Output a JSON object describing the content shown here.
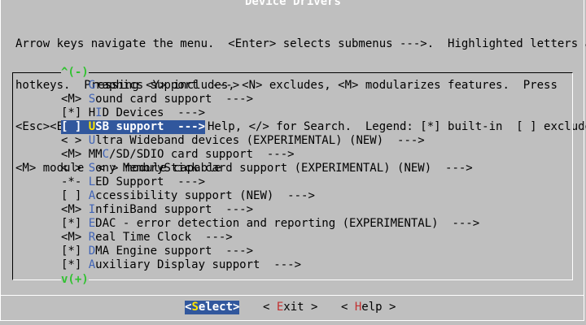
{
  "dialog": {
    "title": "Device Drivers",
    "help_lines": [
      "Arrow keys navigate the menu.  <Enter> selects submenus --->.  Highlighted letters are",
      "hotkeys.  Pressing <Y> includes, <N> excludes, <M> modularizes features.  Press",
      "<Esc><Esc> to exit, <?> for Help, </> for Search.  Legend: [*] built-in  [ ] excluded",
      "<M> module  < > module capable"
    ],
    "scroll_up": "^(-)",
    "scroll_down": "v(+)"
  },
  "menu": {
    "items": [
      {
        "prefix": "    ",
        "hot": "G",
        "rest": "raphics support  --->"
      },
      {
        "prefix": "<M> ",
        "hot": "S",
        "rest": "ound card support  --->"
      },
      {
        "prefix": "[*] ",
        "pre": "H",
        "hot": "I",
        "rest": "D Devices  --->"
      },
      {
        "prefix": "[ ] ",
        "hot": "U",
        "rest": "SB support  --->",
        "selected": true
      },
      {
        "prefix": "< > ",
        "hot": "U",
        "rest": "ltra Wideband devices (EXPERIMENTAL) (NEW)  --->"
      },
      {
        "prefix": "<M> ",
        "pre": "MM",
        "hot": "C",
        "rest": "/SD/SDIO card support  --->"
      },
      {
        "prefix": "< > ",
        "hot": "S",
        "rest": "ony MemoryStick card support (EXPERIMENTAL) (NEW)  --->"
      },
      {
        "prefix": "-*- ",
        "hot": "L",
        "rest": "ED Support  --->"
      },
      {
        "prefix": "[ ] ",
        "hot": "A",
        "rest": "ccessibility support (NEW)  --->"
      },
      {
        "prefix": "<M> ",
        "hot": "I",
        "rest": "nfiniBand support  --->"
      },
      {
        "prefix": "[*] ",
        "hot": "E",
        "rest": "DAC - error detection and reporting (EXPERIMENTAL)  --->"
      },
      {
        "prefix": "<M> ",
        "hot": "R",
        "rest": "eal Time Clock  --->"
      },
      {
        "prefix": "[*] ",
        "hot": "D",
        "rest": "MA Engine support  --->"
      },
      {
        "prefix": "[*] ",
        "hot": "A",
        "rest": "uxiliary Display support  --->"
      }
    ]
  },
  "buttons": {
    "select": {
      "open": "<",
      "hot": "S",
      "rest": "elect>"
    },
    "exit": {
      "open": "< ",
      "hot": "E",
      "rest": "xit >"
    },
    "help": {
      "open": "< ",
      "hot": "H",
      "rest": "elp >"
    }
  },
  "colors": {
    "background": "#bfbfbf",
    "highlight": "#31579d",
    "hotkey": "#3f63b6",
    "selected_hotkey": "#ffe600",
    "button_hotkey": "#c23030",
    "scroll_indicator": "#30c230"
  }
}
